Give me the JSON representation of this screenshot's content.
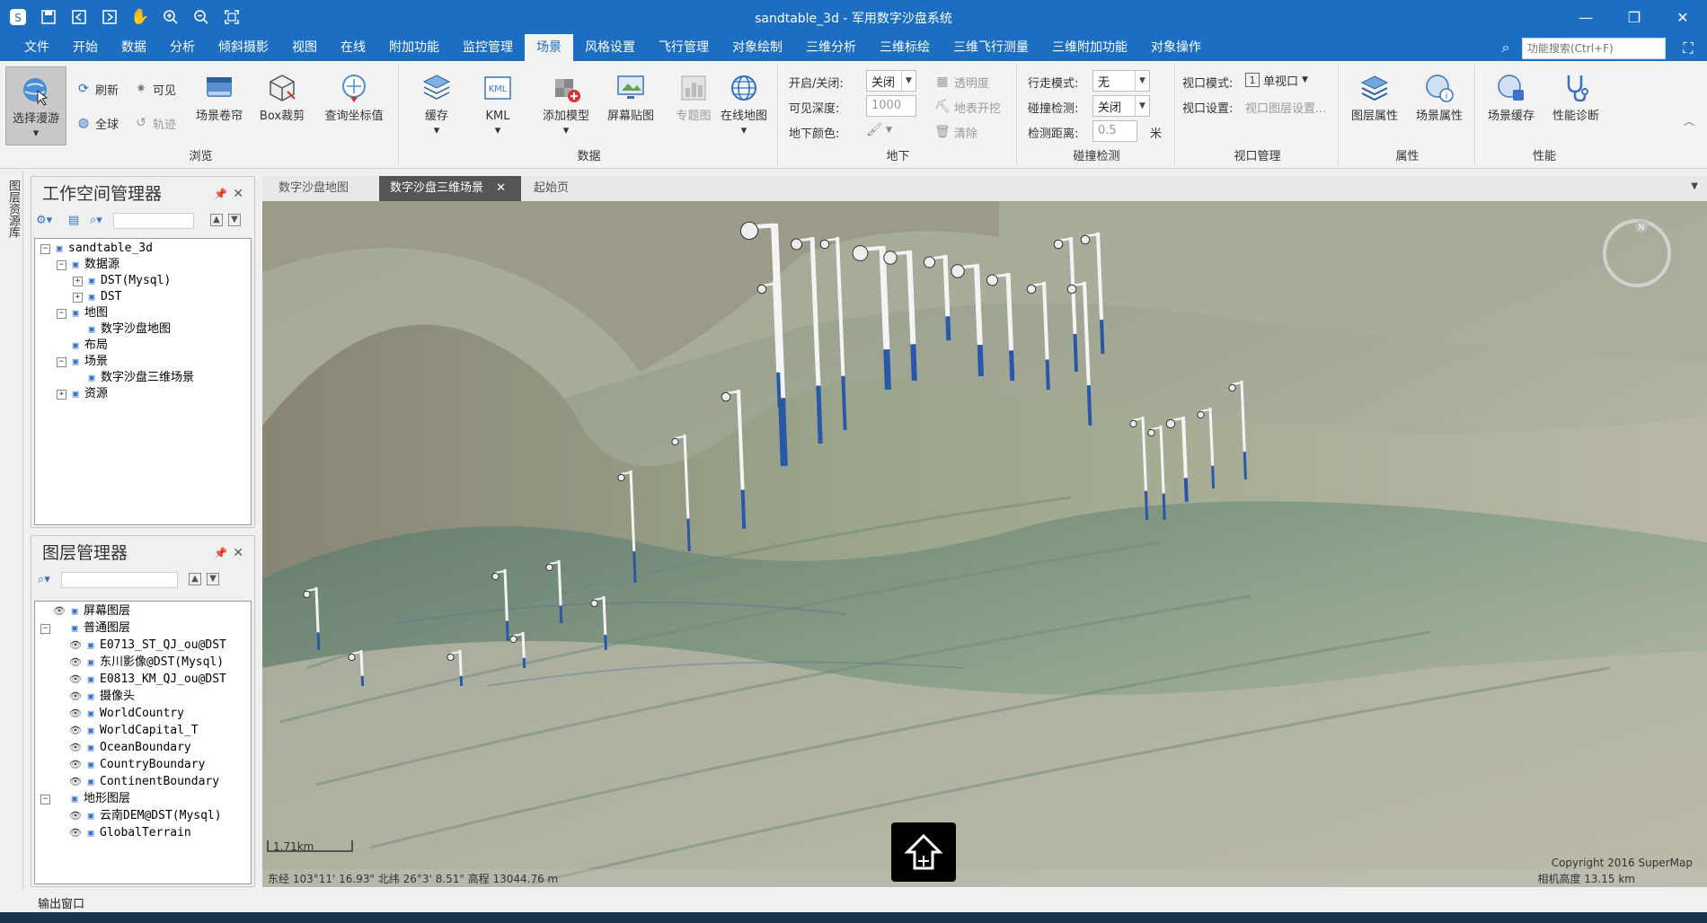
{
  "window": {
    "title": "sandtable_3d - 军用数字沙盘系统",
    "controls": [
      "—",
      "❐",
      "✕"
    ]
  },
  "menu": {
    "items": [
      "文件",
      "开始",
      "数据",
      "分析",
      "倾斜摄影",
      "视图",
      "在线",
      "附加功能",
      "监控管理",
      "场景",
      "风格设置",
      "飞行管理",
      "对象绘制",
      "三维分析",
      "三维标绘",
      "三维飞行测量",
      "三维附加功能",
      "对象操作"
    ],
    "active": "场景",
    "search_placeholder": "功能搜索(Ctrl+F)"
  },
  "ribbon": {
    "browse": {
      "label": "浏览",
      "select_roam": "选择漫游",
      "refresh": "刷新",
      "visible": "可见",
      "globe": "全球",
      "track": "轨迹",
      "scene_roll": "场景卷帘",
      "box_clip": "Box裁剪",
      "query_coords": "查询坐标值"
    },
    "data": {
      "label": "数据",
      "cache": "缓存",
      "kml": "KML",
      "add_model": "添加模型",
      "screen_map": "屏幕贴图",
      "thematic": "专题图",
      "online_map": "在线地图"
    },
    "underground": {
      "label": "地下",
      "on_off_label": "开启/关闭:",
      "on_off_value": "关闭",
      "depth_label": "可见深度:",
      "depth_value": "1000",
      "color_label": "地下颜色:",
      "transparency": "透明度",
      "surface_dig": "地表开挖",
      "clear": "清除"
    },
    "collision": {
      "label": "碰撞检测",
      "walk_label": "行走模式:",
      "walk_value": "无",
      "collide_label": "碰撞检测:",
      "collide_value": "关闭",
      "distance_label": "检测距离:",
      "distance_value": "0.5",
      "distance_unit": "米"
    },
    "viewport": {
      "label": "视口管理",
      "mode_label": "视口模式:",
      "mode_value": "单视口",
      "mode_num": "1",
      "settings_label": "视口设置:",
      "settings_value": "视口图层设置..."
    },
    "attributes": {
      "label": "属性",
      "layer_attr": "图层属性",
      "scene_attr": "场景属性"
    },
    "performance": {
      "label": "性能",
      "scene_cache": "场景缓存",
      "diagnose": "性能诊断"
    }
  },
  "left_strip": {
    "label": "图层资源库"
  },
  "workspace": {
    "title": "工作空间管理器",
    "nodes": [
      {
        "text": "sandtable_3d",
        "level": 0,
        "toggle": "⊟",
        "icon": "workspace-icon"
      },
      {
        "text": "数据源",
        "level": 1,
        "toggle": "⊟",
        "icon": "datasource-icon"
      },
      {
        "text": "DST(Mysql)",
        "level": 2,
        "toggle": "⊞",
        "icon": "database-icon"
      },
      {
        "text": "DST",
        "level": 2,
        "toggle": "⊞",
        "icon": "database-icon"
      },
      {
        "text": "地图",
        "level": 1,
        "toggle": "⊟",
        "icon": "map-folder-icon"
      },
      {
        "text": "数字沙盘地图",
        "level": 2,
        "toggle": "",
        "icon": "map-icon"
      },
      {
        "text": "布局",
        "level": 1,
        "toggle": "",
        "icon": "layout-icon"
      },
      {
        "text": "场景",
        "level": 1,
        "toggle": "⊟",
        "icon": "scene-folder-icon"
      },
      {
        "text": "数字沙盘三维场景",
        "level": 2,
        "toggle": "",
        "icon": "scene-icon"
      },
      {
        "text": "资源",
        "level": 1,
        "toggle": "⊞",
        "icon": "resource-icon"
      }
    ]
  },
  "layers": {
    "title": "图层管理器",
    "nodes": [
      {
        "text": "屏幕图层",
        "level": 0,
        "toggle": "",
        "eye": true
      },
      {
        "text": "普通图层",
        "level": 0,
        "toggle": "⊟",
        "eye": false
      },
      {
        "text": "E0713_ST_QJ_ou@DST",
        "level": 1,
        "toggle": "",
        "eye": true
      },
      {
        "text": "东川影像@DST(Mysql)",
        "level": 1,
        "toggle": "",
        "eye": true
      },
      {
        "text": "E0813_KM_QJ_ou@DST",
        "level": 1,
        "toggle": "",
        "eye": true
      },
      {
        "text": "摄像头",
        "level": 1,
        "toggle": "",
        "eye": true
      },
      {
        "text": "WorldCountry",
        "level": 1,
        "toggle": "",
        "eye": true
      },
      {
        "text": "WorldCapital_T",
        "level": 1,
        "toggle": "",
        "eye": true
      },
      {
        "text": "OceanBoundary",
        "level": 1,
        "toggle": "",
        "eye": true
      },
      {
        "text": "CountryBoundary",
        "level": 1,
        "toggle": "",
        "eye": true
      },
      {
        "text": "ContinentBoundary",
        "level": 1,
        "toggle": "",
        "eye": true
      },
      {
        "text": "地形图层",
        "level": 0,
        "toggle": "⊟",
        "eye": false
      },
      {
        "text": "云南DEM@DST(Mysql)",
        "level": 1,
        "toggle": "",
        "eye": true
      },
      {
        "text": "GlobalTerrain",
        "level": 1,
        "toggle": "",
        "eye": true
      }
    ]
  },
  "doc_tabs": [
    "数字沙盘地图",
    "数字沙盘三维场景",
    "起始页"
  ],
  "active_tab": "数字沙盘三维场景",
  "scene": {
    "scale": "1.71km",
    "status": "东经 103°11' 16.93\"   北纬 26°3' 8.51\"   高程 13044.76 m",
    "copyright": "Copyright 2016 SuperMap",
    "camera_height": "相机高度 13.15 km",
    "compass": "N"
  },
  "output": {
    "label": "输出窗口"
  },
  "colors": {
    "accent": "#1b6ec2",
    "pole_blue": "#2a58a8"
  }
}
